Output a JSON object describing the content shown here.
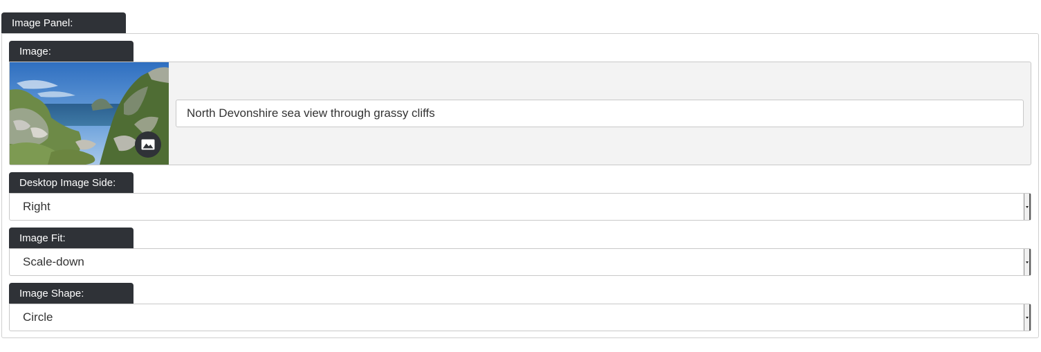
{
  "panel": {
    "title": "Image Panel:"
  },
  "image_field": {
    "label": "Image:",
    "alt_text": "North Devonshire sea view through grassy cliffs",
    "badge_icon": "image-icon"
  },
  "desktop_image_side": {
    "label": "Desktop Image Side:",
    "value": "Right"
  },
  "image_fit": {
    "label": "Image Fit:",
    "value": "Scale-down"
  },
  "image_shape": {
    "label": "Image Shape:",
    "value": "Circle"
  },
  "colors": {
    "tab_background": "#2f3237",
    "tab_text": "#ffffff",
    "field_border": "#c8c8c8",
    "image_box_background": "#f3f3f3"
  }
}
